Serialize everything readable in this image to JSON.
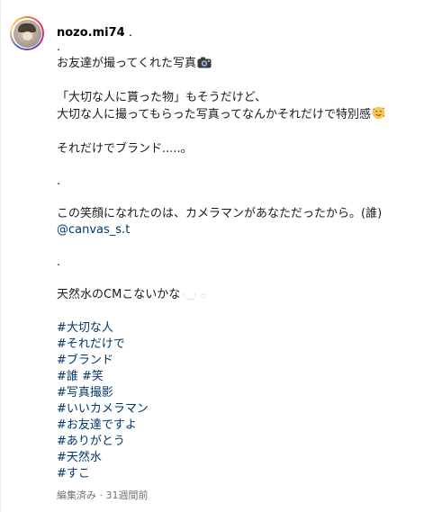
{
  "post": {
    "username": "nozo.mi74",
    "username_suffix": " .",
    "caption_lines": {
      "l1": ".",
      "l2": "お友達が撮ってくれた写真",
      "l3": "「大切な人に貰った物」もそうだけど、",
      "l4": "大切な人に撮ってもらった写真ってなんかそれだけで特別感",
      "l5": "それだけでブランド.....。",
      "l6": ".",
      "l7": "この笑顔になれたのは、カメラマンがあなただったから。(誰)",
      "l8_mention": "@canvas_s.t",
      "l9": ".",
      "l10": "天然水のCMこないかな",
      "l10_faint": "◦‿◦ ෆ"
    },
    "hashtags": [
      "#大切な人",
      "#それだけで",
      "#ブランド",
      "#誰 #笑",
      "#写真撮影",
      "#いいカメラマン",
      "#お友達ですよ",
      "#ありがとう",
      "#天然水",
      "#すこ"
    ],
    "meta": "編集済み · 31週間前",
    "icons": {
      "camera": "camera-icon",
      "smiling_face_hearts": "smiling-face-with-hearts-icon"
    },
    "colors": {
      "link": "#00376b",
      "meta": "#737373"
    }
  }
}
